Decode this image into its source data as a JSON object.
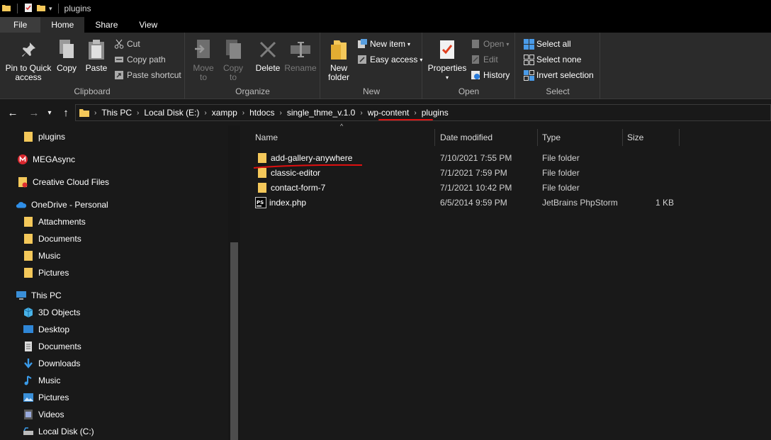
{
  "window": {
    "title": "plugins"
  },
  "tabs": {
    "file": "File",
    "home": "Home",
    "share": "Share",
    "view": "View"
  },
  "ribbon": {
    "clipboard": {
      "label": "Clipboard",
      "pin_line1": "Pin to Quick",
      "pin_line2": "access",
      "copy": "Copy",
      "paste": "Paste",
      "cut": "Cut",
      "copy_path": "Copy path",
      "paste_shortcut": "Paste shortcut"
    },
    "organize": {
      "label": "Organize",
      "move_to_l1": "Move",
      "move_to_l2": "to",
      "copy_to_l1": "Copy",
      "copy_to_l2": "to",
      "delete": "Delete",
      "rename": "Rename"
    },
    "new": {
      "label": "New",
      "new_folder_l1": "New",
      "new_folder_l2": "folder",
      "new_item": "New item",
      "easy_access": "Easy access"
    },
    "open": {
      "label": "Open",
      "properties": "Properties",
      "open": "Open",
      "edit": "Edit",
      "history": "History"
    },
    "select": {
      "label": "Select",
      "select_all": "Select all",
      "select_none": "Select none",
      "invert": "Invert selection"
    }
  },
  "address": {
    "crumbs": [
      "This PC",
      "Local Disk (E:)",
      "xampp",
      "htdocs",
      "single_thme_v.1.0",
      "wp-content",
      "plugins"
    ]
  },
  "nav": {
    "items": [
      {
        "label": "plugins",
        "icon": "folder-icon"
      },
      {
        "label": "MEGAsync",
        "icon": "megasync-icon"
      },
      {
        "label": "Creative Cloud Files",
        "icon": "creative-cloud-folder-icon"
      },
      {
        "label": "OneDrive - Personal",
        "icon": "onedrive-icon"
      },
      {
        "label": "Attachments",
        "icon": "folder-icon"
      },
      {
        "label": "Documents",
        "icon": "folder-icon"
      },
      {
        "label": "Music",
        "icon": "folder-icon"
      },
      {
        "label": "Pictures",
        "icon": "folder-icon"
      },
      {
        "label": "This PC",
        "icon": "computer-icon"
      },
      {
        "label": "3D Objects",
        "icon": "3d-objects-icon"
      },
      {
        "label": "Desktop",
        "icon": "desktop-icon"
      },
      {
        "label": "Documents",
        "icon": "documents-icon"
      },
      {
        "label": "Downloads",
        "icon": "downloads-icon"
      },
      {
        "label": "Music",
        "icon": "music-icon"
      },
      {
        "label": "Pictures",
        "icon": "pictures-icon"
      },
      {
        "label": "Videos",
        "icon": "videos-icon"
      },
      {
        "label": "Local Disk (C:)",
        "icon": "drive-icon"
      }
    ]
  },
  "files": {
    "columns": {
      "name": "Name",
      "date": "Date modified",
      "type": "Type",
      "size": "Size"
    },
    "rows": [
      {
        "name": "add-gallery-anywhere",
        "date": "7/10/2021 7:55 PM",
        "type": "File folder",
        "size": "",
        "icon": "folder-icon"
      },
      {
        "name": "classic-editor",
        "date": "7/1/2021 7:59 PM",
        "type": "File folder",
        "size": "",
        "icon": "folder-icon"
      },
      {
        "name": "contact-form-7",
        "date": "7/1/2021 10:42 PM",
        "type": "File folder",
        "size": "",
        "icon": "folder-icon"
      },
      {
        "name": "index.php",
        "date": "6/5/2014 9:59 PM",
        "type": "JetBrains PhpStorm",
        "size": "1 KB",
        "icon": "phpstorm-file-icon"
      }
    ]
  },
  "colors": {
    "annotation": "#e01010",
    "folder": "#f4c85a",
    "accent": "#0a84ff"
  }
}
